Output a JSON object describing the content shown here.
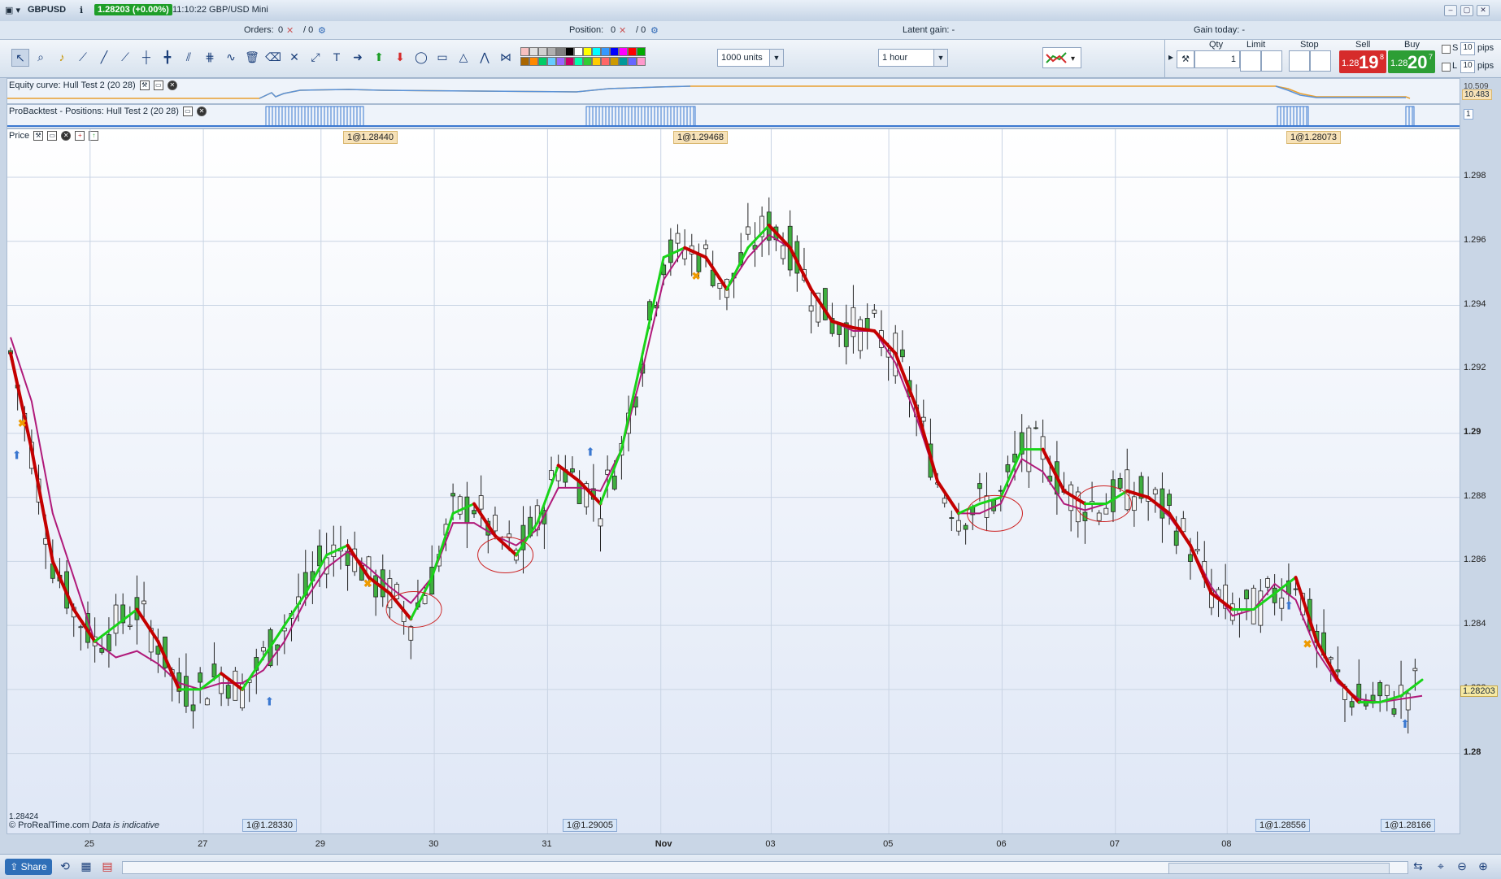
{
  "title": {
    "instrument": "GBPUSD",
    "price": "1.28203 (+0.00%)",
    "time_desc": "11:10:22 GBP/USD Mini"
  },
  "info": {
    "orders_label": "Orders:",
    "orders_a": "0",
    "orders_b": "/ 0",
    "position_label": "Position:",
    "position_a": "0",
    "position_b": "/ 0",
    "latent_gain": "Latent gain: -",
    "gain_today": "Gain today: -"
  },
  "toolbar": {
    "units": "1000 units",
    "timeframe": "1 hour",
    "swatches": [
      "#f7c0c0",
      "#e0e0e0",
      "#d0d0d0",
      "#b0b0b0",
      "#808080",
      "#000000",
      "#ffffff",
      "#ffff00",
      "#00ffff",
      "#3399ff",
      "#0000ff",
      "#ff00ff",
      "#ff0000",
      "#00aa00",
      "#aa6600",
      "#ff8800",
      "#00cc66",
      "#66ccff",
      "#9966ff",
      "#cc0066",
      "#00ffaa",
      "#33cc33",
      "#ffcc00",
      "#ff6666",
      "#cc9900",
      "#009999",
      "#6666ff",
      "#ff99cc"
    ]
  },
  "order_panel": {
    "qty_label": "Qty",
    "qty": "1",
    "limit_label": "Limit",
    "stop_label": "Stop",
    "sell_label": "Sell",
    "buy_label": "Buy",
    "sell_small": "1.28",
    "sell_big": "19",
    "sell_sup": "8",
    "buy_small": "1.28",
    "buy_big": "20",
    "buy_sup": "7",
    "s_label": "S",
    "l_label": "L",
    "s_pips": "10",
    "l_pips": "10",
    "pips": "pips"
  },
  "panels": {
    "equity": "Equity curve: Hull Test 2 (20 28)",
    "equity_value": "10.483",
    "equity_top": "10.509",
    "positions": "ProBacktest - Positions: Hull Test 2 (20 28)",
    "positions_value": "1",
    "price": "Price"
  },
  "chart_data": {
    "type": "candlestick",
    "instrument": "GBPUSD",
    "timeframe": "1 hour",
    "ylim": [
      1.2775,
      1.2995
    ],
    "yticks": [
      "1.298",
      "1.296",
      "1.294",
      "1.292",
      "1.29",
      "1.288",
      "1.286",
      "1.284",
      "1.282",
      "1.28"
    ],
    "xticks": [
      "25",
      "27",
      "29",
      "30",
      "31",
      "Nov",
      "03",
      "05",
      "06",
      "07",
      "08"
    ],
    "last_price": "1.28203",
    "top_tags": [
      "1@1.28440",
      "1@1.29468",
      "1@1.28073"
    ],
    "bottom_tags": [
      "1@1.28330",
      "1@1.29005",
      "1@1.28556",
      "1@1.28166"
    ],
    "left_value": "1.28424",
    "series": [
      {
        "name": "Hull (20)",
        "color": "#cc0000/#00dd00",
        "values": [
          1.2925,
          1.2895,
          1.286,
          1.2845,
          1.2835,
          1.284,
          1.2845,
          1.2835,
          1.282,
          1.282,
          1.2825,
          1.282,
          1.283,
          1.284,
          1.285,
          1.2862,
          1.2865,
          1.2855,
          1.285,
          1.2842,
          1.2855,
          1.2875,
          1.2878,
          1.2868,
          1.2862,
          1.2872,
          1.289,
          1.2885,
          1.2878,
          1.2895,
          1.2925,
          1.2955,
          1.2958,
          1.2955,
          1.2945,
          1.2958,
          1.2965,
          1.2958,
          1.2945,
          1.2935,
          1.2933,
          1.2932,
          1.2925,
          1.2908,
          1.2885,
          1.2875,
          1.2878,
          1.288,
          1.2895,
          1.2895,
          1.2882,
          1.2878,
          1.2878,
          1.2882,
          1.288,
          1.2875,
          1.2865,
          1.285,
          1.2845,
          1.2845,
          1.285,
          1.2855,
          1.2835,
          1.2823,
          1.2816,
          1.2816,
          1.2818,
          1.2823
        ]
      },
      {
        "name": "Hull (28)",
        "color": "#b01a7a",
        "values": [
          1.293,
          1.291,
          1.2875,
          1.2855,
          1.2835,
          1.283,
          1.2832,
          1.2828,
          1.2822,
          1.282,
          1.2822,
          1.2822,
          1.2826,
          1.2835,
          1.2848,
          1.2858,
          1.2863,
          1.2858,
          1.2852,
          1.2847,
          1.2855,
          1.2872,
          1.2872,
          1.2868,
          1.2865,
          1.287,
          1.2883,
          1.2883,
          1.2882,
          1.2895,
          1.292,
          1.2948,
          1.2958,
          1.2955,
          1.2945,
          1.2955,
          1.2962,
          1.2958,
          1.2945,
          1.2935,
          1.2932,
          1.2932,
          1.2922,
          1.2905,
          1.2885,
          1.2875,
          1.2875,
          1.2878,
          1.2892,
          1.2888,
          1.2878,
          1.2876,
          1.2878,
          1.2882,
          1.288,
          1.2874,
          1.2865,
          1.2852,
          1.2843,
          1.2845,
          1.2853,
          1.2848,
          1.2832,
          1.2822,
          1.2817,
          1.2816,
          1.2817,
          1.2818
        ]
      }
    ]
  },
  "footer": {
    "source": "© ProRealTime.com",
    "note": "Data is indicative",
    "share": "Share"
  }
}
